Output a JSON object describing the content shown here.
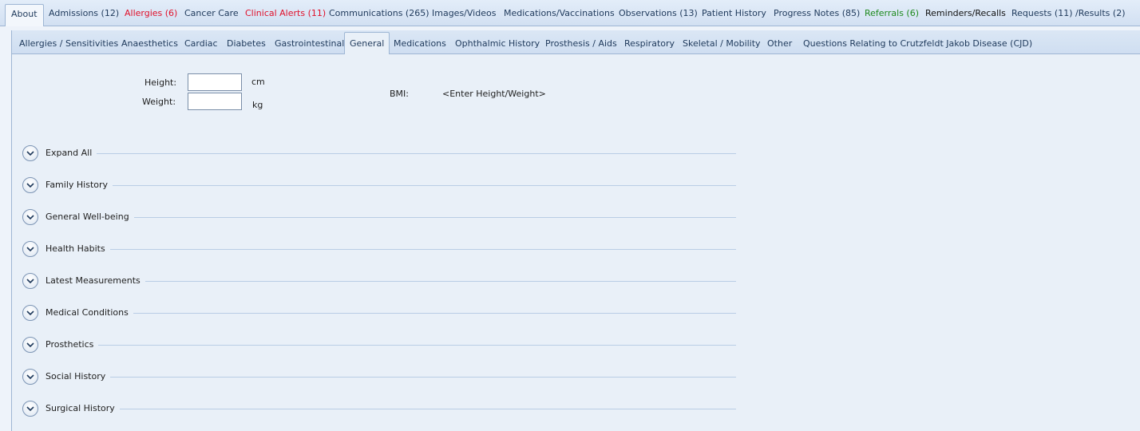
{
  "top_tabs": [
    {
      "label": "About",
      "style": "active"
    },
    {
      "label": "Admissions (12)",
      "style": "normal"
    },
    {
      "label": "Allergies (6)",
      "style": "red"
    },
    {
      "label": "Cancer Care",
      "style": "normal"
    },
    {
      "label": "Clinical Alerts (11)",
      "style": "red"
    },
    {
      "label": "Communications (265)",
      "style": "normal"
    },
    {
      "label": "Images/Videos",
      "style": "normal"
    },
    {
      "label": "Medications/Vaccinations",
      "style": "normal"
    },
    {
      "label": "Observations (13)",
      "style": "normal"
    },
    {
      "label": "Patient History",
      "style": "normal"
    },
    {
      "label": "Progress Notes (85)",
      "style": "normal"
    },
    {
      "label": "Referrals (6)",
      "style": "green"
    },
    {
      "label": "Reminders/Recalls",
      "style": "dark"
    },
    {
      "label": "Requests (11) /Results (2)",
      "style": "normal"
    }
  ],
  "sub_tabs": [
    {
      "label": "Allergies / Sensitivities"
    },
    {
      "label": "Anaesthetics"
    },
    {
      "label": "Cardiac"
    },
    {
      "label": "Diabetes"
    },
    {
      "label": "Gastrointestinal"
    },
    {
      "label": "General",
      "active": true
    },
    {
      "label": "Medications"
    },
    {
      "label": "Ophthalmic History"
    },
    {
      "label": "Prosthesis / Aids"
    },
    {
      "label": "Respiratory"
    },
    {
      "label": "Skeletal / Mobility"
    },
    {
      "label": "Other"
    },
    {
      "label": "Questions Relating to Crutzfeldt Jakob Disease (CJD)"
    }
  ],
  "measurements": {
    "height_label": "Height:",
    "height_value": "",
    "height_unit": "cm",
    "weight_label": "Weight:",
    "weight_value": "",
    "weight_unit": "kg",
    "bmi_label": "BMI:",
    "bmi_value": "<Enter Height/Weight>"
  },
  "sections": [
    {
      "label": "Expand All",
      "icon": "chevron-down-icon"
    },
    {
      "label": "Family History",
      "icon": "chevron-down-icon"
    },
    {
      "label": "General Well-being",
      "icon": "chevron-down-icon"
    },
    {
      "label": "Health Habits",
      "icon": "chevron-down-icon"
    },
    {
      "label": "Latest Measurements",
      "icon": "chevron-down-icon"
    },
    {
      "label": "Medical Conditions",
      "icon": "chevron-down-icon"
    },
    {
      "label": "Prosthetics",
      "icon": "chevron-down-icon"
    },
    {
      "label": "Social History",
      "icon": "chevron-down-icon"
    },
    {
      "label": "Surgical History",
      "icon": "chevron-down-icon"
    }
  ],
  "colors": {
    "alert_red": "#e0102a",
    "referral_green": "#1e8a1e",
    "tab_text": "#1e395b",
    "panel_bg": "#e9f0f8"
  }
}
